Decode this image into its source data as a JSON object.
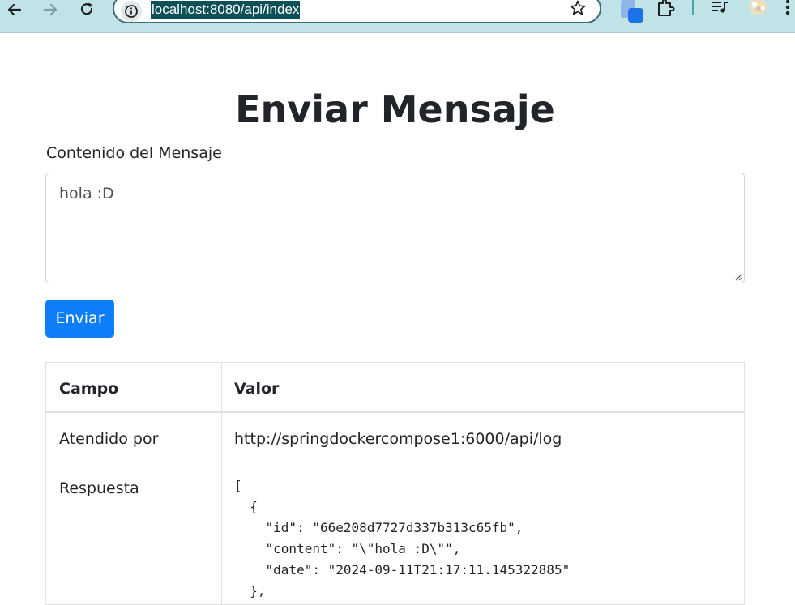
{
  "browser": {
    "url": "localhost:8080/api/index",
    "icons": [
      "back-icon",
      "forward-icon",
      "reload-icon",
      "site-info-icon",
      "bookmark-star-icon",
      "extension-color-icon",
      "extensions-puzzle-icon",
      "media-queue-icon",
      "profile-avatar-icon",
      "more-menu-icon"
    ]
  },
  "page": {
    "title": "Enviar Mensaje",
    "message_label": "Contenido del Mensaje",
    "message_value": "hola :D",
    "send_button": "Enviar"
  },
  "table": {
    "headers": [
      "Campo",
      "Valor"
    ],
    "rows": [
      {
        "field": "Atendido por",
        "value": "http://springdockercompose1:6000/api/log"
      },
      {
        "field": "Respuesta",
        "value": "[\n  {\n    \"id\": \"66e208d7727d337b313c65fb\",\n    \"content\": \"\\\"hola :D\\\"\",\n    \"date\": \"2024-09-11T21:17:11.145322885\"\n  },"
      }
    ]
  },
  "colors": {
    "chrome_bg": "#bfe3e6",
    "url_highlight": "#0b4f57",
    "primary_button": "#0d7ef7",
    "text": "#212529",
    "border": "#dee2e6"
  }
}
